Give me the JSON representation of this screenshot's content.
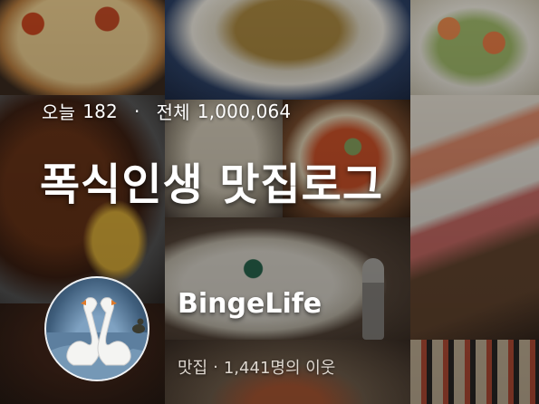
{
  "stats": {
    "today_label": "오늘",
    "today_count": "182",
    "separator": "·",
    "total_label": "전체",
    "total_count": "1,000,064"
  },
  "blog": {
    "title": "폭식인생 맛집로그",
    "blogger_name": "BingeLife",
    "category": "맛집",
    "meta_separator": "·",
    "neighbors": "1,441명의 이웃"
  },
  "avatar": {
    "icon": "swan-icon"
  }
}
